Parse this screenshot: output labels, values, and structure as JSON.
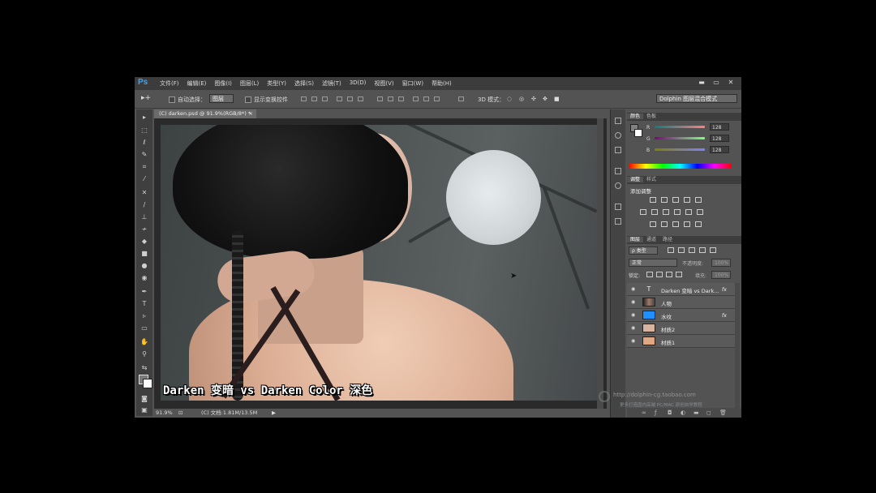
{
  "app": {
    "logo": "Ps",
    "menus": [
      "文件(F)",
      "编辑(E)",
      "图像(I)",
      "图层(L)",
      "类型(Y)",
      "选择(S)",
      "滤镜(T)",
      "3D(D)",
      "视图(V)",
      "窗口(W)",
      "帮助(H)"
    ],
    "window_controls": {
      "minimize": "▬",
      "restore": "▭",
      "close": "✕"
    }
  },
  "options_bar": {
    "auto_select_label": "自动选择：",
    "auto_select_value": "图层",
    "show_transform_label": "显示变换控件",
    "mode_3d_label": "3D 模式：",
    "workspace": "Dolphin 图层混合模式"
  },
  "document": {
    "tab_title": "(C) darken.psd @ 91.9%(RGB/8*) *",
    "tab_close": "×",
    "caption": "Darken 变暗 vs Darken Color 深色",
    "zoom": "91.9%",
    "doc_info": "(C) 文档:1.81M/13.5M",
    "status_arrow": "▶"
  },
  "color_panel": {
    "tabs": [
      "颜色",
      "色板"
    ],
    "channels": [
      {
        "label": "R",
        "value": "128"
      },
      {
        "label": "G",
        "value": "128"
      },
      {
        "label": "B",
        "value": "128"
      }
    ]
  },
  "adjust_panel": {
    "tabs": [
      "调整",
      "样式"
    ],
    "title": "添加调整"
  },
  "layers_panel": {
    "tabs": [
      "图层",
      "通道",
      "路径"
    ],
    "filter_label": "ρ 类型",
    "blend_mode": "正常",
    "opacity_label": "不透明度:",
    "opacity_value": "100%",
    "lock_label": "锁定:",
    "fill_label": "填充:",
    "fill_value": "100%",
    "layers": [
      {
        "name": "Darken 变暗 vs Dark...",
        "kind": "text",
        "fx": "fx"
      },
      {
        "name": "人物",
        "kind": "image",
        "fx": ""
      },
      {
        "name": "水纹",
        "kind": "blue",
        "fx": "fx"
      },
      {
        "name": "材质2",
        "kind": "texture",
        "fx": ""
      },
      {
        "name": "材质1",
        "kind": "texture2",
        "fx": ""
      }
    ]
  },
  "watermark": {
    "url": "http://dolphin-cg.taobao.com",
    "subtitle": "更多打造国内高端 PC/MAC 原创自学教程"
  },
  "colors": {
    "ui_dark": "#3c3c3c",
    "ui_mid": "#535353",
    "ps_blue": "#31a8ff",
    "layer_blue_thumb": "#1e90ff"
  }
}
